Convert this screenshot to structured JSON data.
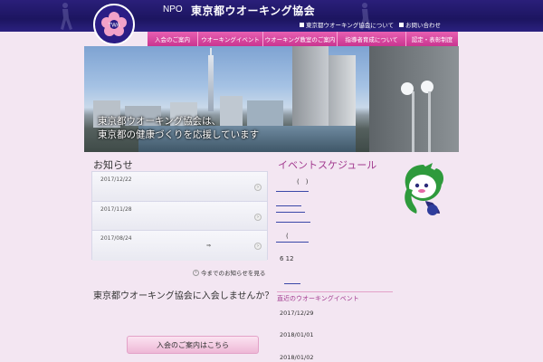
{
  "header": {
    "npo": "NPO",
    "title": "東京都ウオーキング協会",
    "about_link": "東京都ウオーキング協会について",
    "contact_link": "お問い合わせ"
  },
  "logo": {
    "text": "TWA"
  },
  "nav": [
    "入会のご案内",
    "ウオーキングイベント",
    "ウオーキング教室のご案内",
    "指導者育成について",
    "認定・表彰制度"
  ],
  "hero": {
    "line1": "東京都ウオーキング協会は、",
    "line2": "東京都の健康づくりを応援しています"
  },
  "news": {
    "title": "お知らせ",
    "items": [
      {
        "date": "2017/12/22"
      },
      {
        "date": "2017/11/28"
      },
      {
        "date": "2017/08/24"
      }
    ],
    "inline_arrow": "⇒",
    "more": "今までのお知らせを見る"
  },
  "join": {
    "question": "東京都ウオーキング協会に入会しませんか？",
    "button": "入会のご案内はこちら"
  },
  "events": {
    "title": "イベントスケジュール",
    "paren": "(　)",
    "open_paren": "(",
    "nums": "6  12",
    "recent_title": "直近のウオーキングイベント",
    "recent_dates": [
      "2017/12/29",
      "2018/01/01",
      "2018/01/02"
    ]
  },
  "colors": {
    "header_bg": "#1c1560",
    "nav_pink": "#d7449f",
    "accent_purple": "#a23a8f",
    "page_bg": "#f3e6f2"
  }
}
